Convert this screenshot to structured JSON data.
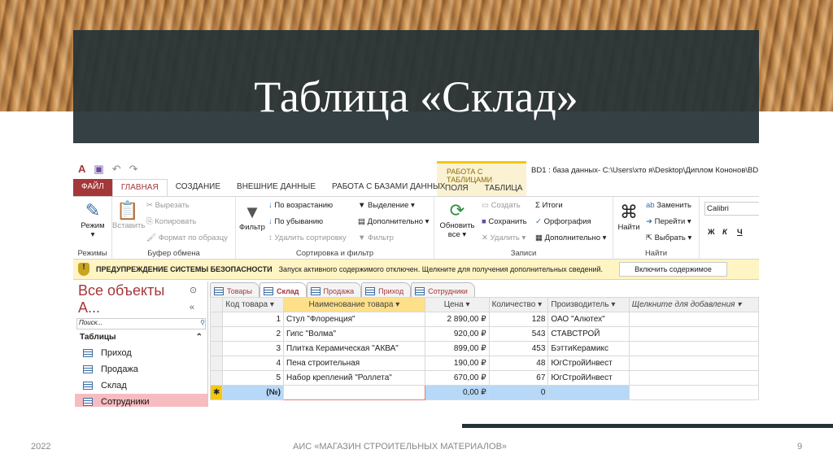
{
  "slide": {
    "title": "Таблица «Склад»",
    "footer_year": "2022",
    "footer_text": "АИС «МАГАЗИН СТРОИТЕЛЬНЫХ МАТЕРИАЛОВ»",
    "page_number": "9"
  },
  "app": {
    "window_title": "BD1 : база данных- C:\\Users\\хто я\\Desktop\\Диплом Кононов\\BD",
    "context_group": "РАБОТА С ТАБЛИЦАМИ",
    "tabs": [
      "ФАЙЛ",
      "ГЛАВНАЯ",
      "СОЗДАНИЕ",
      "ВНЕШНИЕ ДАННЫЕ",
      "РАБОТА С БАЗАМИ ДАННЫХ"
    ],
    "context_tabs": [
      "ПОЛЯ",
      "ТАБЛИЦА"
    ]
  },
  "ribbon": {
    "modes": {
      "mode": "Режим",
      "label": "Режимы"
    },
    "clipboard": {
      "paste": "Вставить",
      "cut": "Вырезать",
      "copy": "Копировать",
      "format": "Формат по образцу",
      "label": "Буфер обмена"
    },
    "sort": {
      "filter": "Фильтр",
      "asc": "По возрастанию",
      "desc": "По убыванию",
      "remove": "Удалить сортировку",
      "selection": "Выделение",
      "advanced": "Дополнительно",
      "toggle": "Фильтр",
      "label": "Сортировка и фильтр"
    },
    "records": {
      "refresh": "Обновить все",
      "new": "Создать",
      "save": "Сохранить",
      "delete": "Удалить",
      "totals": "Итоги",
      "spelling": "Орфография",
      "more": "Дополнительно",
      "label": "Записи"
    },
    "find": {
      "find": "Найти",
      "replace": "Заменить",
      "goto": "Перейти",
      "select": "Выбрать",
      "label": "Найти"
    },
    "font": {
      "name": "Calibri",
      "bold": "Ж",
      "italic": "К",
      "underline": "Ч"
    }
  },
  "warning": {
    "title": "ПРЕДУПРЕЖДЕНИЕ СИСТЕМЫ БЕЗОПАСНОСТИ",
    "text": "Запуск активного содержимого отключен. Щелкните для получения дополнительных сведений.",
    "button": "Включить содержимое"
  },
  "nav": {
    "title": "Все объекты А...",
    "search_placeholder": "Поиск...",
    "section": "Таблицы",
    "items": [
      "Приход",
      "Продажа",
      "Склад",
      "Сотрудники"
    ]
  },
  "doc_tabs": [
    "Товары",
    "Склад",
    "Продажа",
    "Приход",
    "Сотрудники"
  ],
  "table": {
    "columns": [
      "Код товара",
      "Наименование товара",
      "Цена",
      "Количество",
      "Производитель",
      "Щелкните для добавления"
    ],
    "rows": [
      [
        "1",
        "Стул \"Флоренция\"",
        "2 890,00 ₽",
        "128",
        "ОАО \"Алютех\""
      ],
      [
        "2",
        "Гипс \"Волма\"",
        "920,00 ₽",
        "543",
        "СТАВСТРОЙ"
      ],
      [
        "3",
        "Плитка Керамическая \"АКВА\"",
        "899,00 ₽",
        "453",
        "БэттиКерамикс"
      ],
      [
        "4",
        "Пена строительная",
        "190,00 ₽",
        "48",
        "ЮгСтройИнвест"
      ],
      [
        "5",
        "Набор креплений \"Роллета\"",
        "670,00 ₽",
        "67",
        "ЮгСтройИнвест"
      ]
    ],
    "new_row": [
      "(№)",
      "",
      "0,00 ₽",
      "0",
      ""
    ]
  },
  "colors": {
    "accent": "#a4373a",
    "title_box": "#263236",
    "warning_bg": "#fff4c3"
  }
}
